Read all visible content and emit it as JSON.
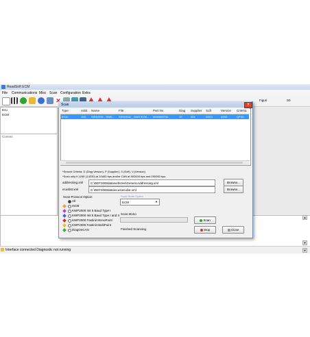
{
  "app": {
    "title": "ReadSoft ECM"
  },
  "menu": [
    "File",
    "Communications",
    "Misc",
    "Scan",
    "Configuration",
    "Extra"
  ],
  "toolbar_readout": {
    "label": "Figuri",
    "value": "S0"
  },
  "left_pane": {
    "header": "Ecu",
    "item": "ECM"
  },
  "left_pane2": {
    "header": "Comms"
  },
  "status": {
    "text": "Interface connected Diagnostic not running"
  },
  "dialog": {
    "title": "Scan",
    "close_label": "X",
    "grid": {
      "columns": [
        "Type",
        "Addr.",
        "Name",
        "File",
        "Part No",
        "Diag",
        "Supplier",
        "Soft",
        "Version",
        "Criteria"
      ],
      "rows": [
        [
          "ECM",
          "10D",
          "SIRIUS32 - SW0...",
          "SIRIUS32__SW0 3130...",
          "0000005734",
          "1E",
          "001",
          "S0G1",
          "A200",
          "QPS0"
        ]
      ]
    },
    "note1": "*Search Criteria: D (Diag Version), P (Supplier), S (Soft), V (Version)",
    "note2": "*Scan only K LINE (14230) at 10400 bps and/or CAN at 500000 bps and 250000 bps",
    "addressing_label": "addressing.xml",
    "addressing_value": "C:\\DDT2000data\\vehicles\\GenericAddressing.xml",
    "ecu_label": "ecuslist.xml",
    "ecu_value": "C:\\DDT2000data\\ecus\\eculist.xml",
    "browse_label": "Browse...",
    "protocol_title": "Scan Protocol Option",
    "protocols": [
      "All",
      "ISO8",
      "KWP2000 Init 5 Baud Type I",
      "KWP2000 Init 5 Baud Type I and II",
      "KWP2000 Fastinit MonoPoint",
      "KWP2000 Fastinit MultiPoint",
      "DiagOnCAN"
    ],
    "ecu_type_label": "Scan Mode Option",
    "ecu_type_value": "ECM",
    "scan_mode_label": "Scan Mono",
    "finished_text": "Finished Scanning",
    "scan_label": "Scan",
    "stop_label": "Stop",
    "close_button_label": "Close"
  },
  "colors": {
    "selection": "#3399ff",
    "accent": "#3b7bd6"
  }
}
